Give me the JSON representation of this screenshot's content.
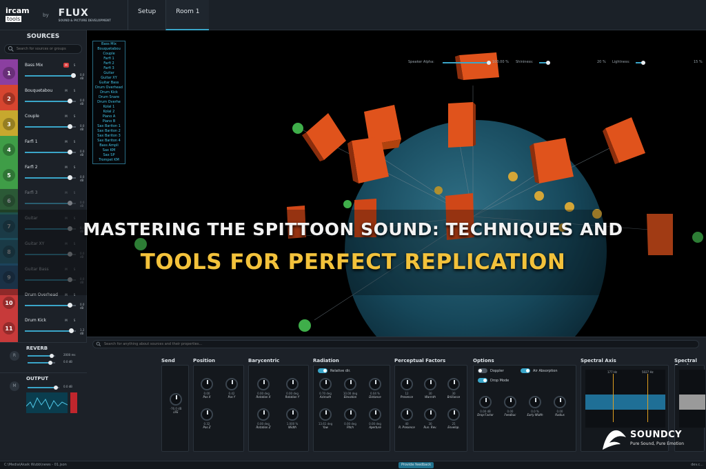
{
  "app": {
    "logo_ircam": "ircam",
    "logo_tools": "tools",
    "logo_by": "by",
    "logo_flux": "FLUX",
    "logo_flux_sub": "SOUND & PICTURE DEVELOPMENT",
    "tabs": [
      {
        "label": "Setup"
      },
      {
        "label": "Room 1"
      }
    ]
  },
  "sidebar": {
    "title": "SOURCES",
    "search_placeholder": "Search for sources or groups",
    "sources": [
      {
        "number": "1",
        "name": "Bass Mix",
        "db": "0.0 dB",
        "color": "#8b3fa0",
        "mute_on": true,
        "level": 0.95
      },
      {
        "number": "2",
        "name": "Bouquetabou",
        "db": "0.0 dB",
        "color": "#d6452f",
        "mute_on": false,
        "level": 0.88
      },
      {
        "number": "3",
        "name": "Couple",
        "db": "0.0 dB",
        "color": "#c7a82e",
        "mute_on": false,
        "level": 0.88
      },
      {
        "number": "4",
        "name": "Farfi 1",
        "db": "0.0 dB",
        "color": "#3f9d47",
        "mute_on": false,
        "level": 0.88
      },
      {
        "number": "5",
        "name": "Farfi 2",
        "db": "0.0 dB",
        "color": "#3f9d47",
        "mute_on": false,
        "level": 0.88
      },
      {
        "number": "6",
        "name": "Farfi 3",
        "db": "0.0 dB",
        "color": "#3f9d47",
        "mute_on": false,
        "level": 0.88
      },
      {
        "number": "7",
        "name": "Guitar",
        "db": "0.0 dB",
        "color": "#2f8ca6",
        "mute_on": false,
        "level": 0.88
      },
      {
        "number": "8",
        "name": "Guitar XY",
        "db": "0.0 dB",
        "color": "#2f8ca6",
        "mute_on": false,
        "level": 0.88
      },
      {
        "number": "9",
        "name": "Guitar Bass",
        "db": "0.0 dB",
        "color": "#2f6fa6",
        "mute_on": false,
        "level": 0.88
      },
      {
        "number": "10",
        "name": "Drum Overhead",
        "db": "0.0 dB",
        "color": "#c73a3a",
        "mute_on": false,
        "level": 0.88
      },
      {
        "number": "11",
        "name": "Drum Kick",
        "db": "1.2 dB",
        "color": "#c73a3a",
        "mute_on": false,
        "level": 0.9
      }
    ],
    "mute_label": "M",
    "solo_label": "S",
    "reverb": {
      "title": "REVERB",
      "val1": "2000 ms",
      "val2": "0.0 dB",
      "icon_letter": "R"
    },
    "output": {
      "title": "OUTPUT",
      "val1": "0.0 dB",
      "icon_letter": "M"
    }
  },
  "scene": {
    "speaker_alpha_label": "Speaker Alpha:",
    "speaker_alpha_value": "100.00 %",
    "shininess_label": "Shininess:",
    "shininess_value": "20 %",
    "lightness_label": "Lightness:",
    "lightness_value": "15 %",
    "channels": [
      "Bass Mix",
      "Bouquetabou",
      "Couple",
      "Farfi 1",
      "Farfi 2",
      "Farfi 3",
      "Guitar",
      "Guitar XY",
      "Guitar Bass",
      "Drum Overhead",
      "Drum Kick",
      "Drum Snare",
      "Drum Overhe",
      "Kolal 1",
      "Kolal 2",
      "Piano A",
      "Piano B",
      "Sax Bariton 1",
      "Sax Bariton 2",
      "Sax Bariton 3",
      "Sax Bariton 4",
      "Bass Ampli",
      "Sax KM",
      "Sax SP",
      "Trompet KM"
    ]
  },
  "headline": {
    "line1": "MASTERING THE SPITTOON SOUND: TECHNIQUES AND",
    "line2": "TOOLS FOR PERFECT REPLICATION"
  },
  "panel": {
    "search_placeholder": "Search for anything about sources and their properties...",
    "groups": {
      "send": "Send",
      "position": "Position",
      "barycentric": "Barycentric",
      "radiation": "Radiation",
      "perceptual": "Perceptual Factors",
      "options": "Options",
      "spectral_axis": "Spectral Axis",
      "spectral_omni": "Spectral Omni"
    },
    "relative_dir": "Relative dir.",
    "options_labels": {
      "doppler": "Doppler",
      "air_absorption": "Air Absorption",
      "drop_mode": "Drop Mode"
    },
    "knobs": {
      "send": [
        {
          "v": "-76.0 dB",
          "n": "LFE"
        }
      ],
      "position": [
        {
          "v": "0.00",
          "n": "Pos X"
        },
        {
          "v": "0.42",
          "n": "Pos Y"
        },
        {
          "v": "0.32",
          "n": "Pos Z"
        }
      ],
      "barycentric": [
        {
          "v": "0.00 deg",
          "n": "Rotation X"
        },
        {
          "v": "0.00 deg",
          "n": "Rotation Y"
        },
        {
          "v": "0.00 deg",
          "n": "Rotation Z"
        },
        {
          "v": "1.000 %",
          "n": "Width"
        }
      ],
      "radiation": [
        {
          "v": "0.70 deg",
          "n": "Azimuth"
        },
        {
          "v": "10.00 deg",
          "n": "Elevation"
        },
        {
          "v": "0.04 %",
          "n": "Distance"
        },
        {
          "v": "13.61 deg",
          "n": "Yaw"
        },
        {
          "v": "0.00 deg",
          "n": "Pitch"
        },
        {
          "v": "0.00 deg",
          "n": "Aperture"
        }
      ],
      "perceptual": [
        {
          "v": "12",
          "n": "Presence"
        },
        {
          "v": "30",
          "n": "Warmth"
        },
        {
          "v": "30",
          "n": "Brilliance"
        },
        {
          "v": "40",
          "n": "R. Presence"
        },
        {
          "v": "30",
          "n": "Run. Rev."
        },
        {
          "v": "25",
          "n": "Envelop."
        }
      ],
      "options": [
        {
          "v": "0.00 dB",
          "n": "Drop Factor"
        },
        {
          "v": "0.00",
          "n": "Feedbac"
        },
        {
          "v": "0.0 %",
          "n": "Early Width"
        },
        {
          "v": "0.00",
          "n": "Radius"
        }
      ]
    },
    "spectral_axis_vals": {
      "a": "177 Hz",
      "b": "5027 Hz"
    }
  },
  "status": {
    "path": "C:\\Media\\Akaik Wubb\\news - 01.json",
    "feedback": "Provide feedback",
    "right": "dev.c..."
  },
  "watermark": {
    "brand": "SOUNDCY",
    "tagline": "Pure Sound, Pure Emotion"
  },
  "colors": {
    "accent": "#3aa6c9",
    "headline_yellow": "#f3c23b",
    "speaker_orange": "#e0531c"
  }
}
